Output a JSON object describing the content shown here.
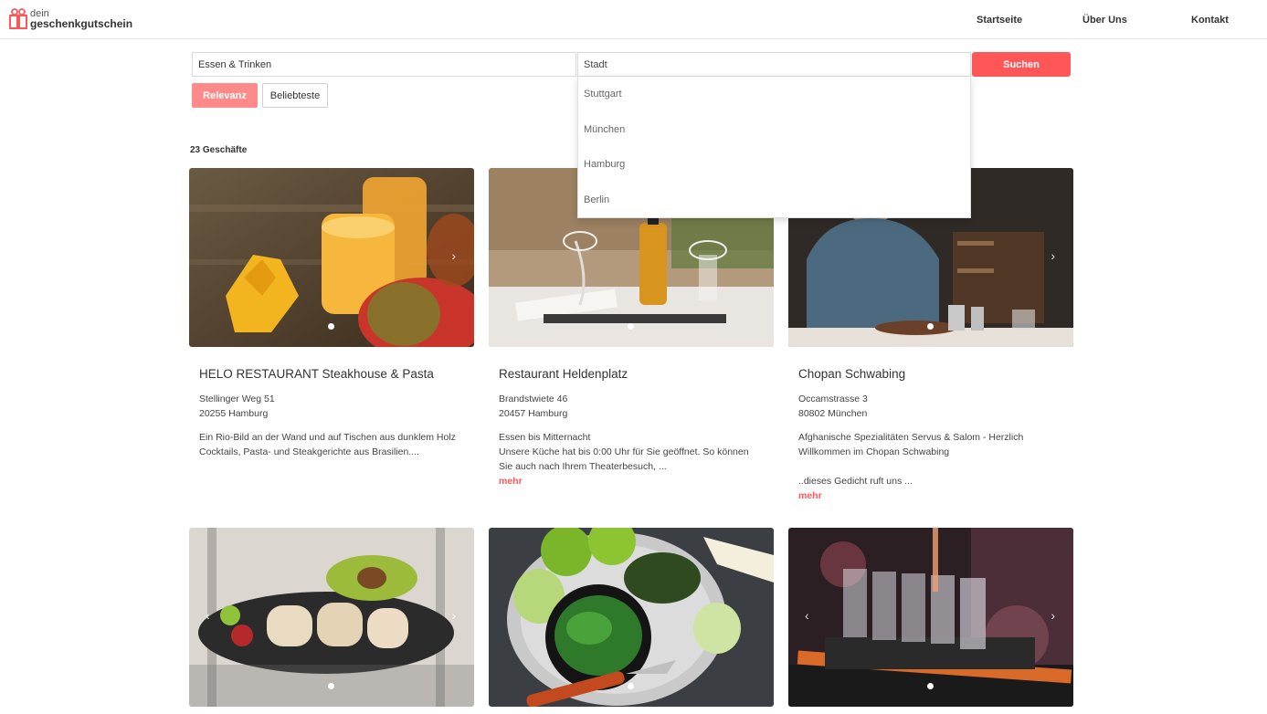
{
  "header": {
    "logo_small": "dein",
    "logo_big": "geschenkgutschein",
    "nav": [
      "Startseite",
      "Über Uns",
      "Kontakt"
    ]
  },
  "search": {
    "category_value": "Essen & Trinken",
    "city_placeholder": "Stadt",
    "submit_label": "Suchen",
    "city_options": [
      "Stuttgart",
      "München",
      "Hamburg",
      "Berlin"
    ]
  },
  "sort": {
    "relevanz": "Relevanz",
    "beliebteste": "Beliebteste"
  },
  "results": {
    "count_label": "23 Geschäfte"
  },
  "colors": {
    "accent": "#ff5757",
    "accent_light": "#ff8a8a"
  },
  "cards": [
    {
      "title": "HELO RESTAURANT Steakhouse & Pasta",
      "street": "Stellinger Weg 51",
      "city": "20255 Hamburg",
      "desc1": "Ein Rio-Bild an der Wand und auf Tischen aus dunklem Holz\nCocktails, Pasta- und Steakgerichte aus Brasilien....",
      "image": "mango-juice-photo"
    },
    {
      "title": "Restaurant Heldenplatz",
      "street": "Brandstwiete 46",
      "city": "20457 Hamburg",
      "desc1": "Essen bis Mitternacht\nUnsere Küche hat bis 0:00 Uhr für Sie geöffnet. So können\nSie auch nach Ihrem Theaterbesuch, ...",
      "more": "mehr",
      "image": "table-glasses-photo"
    },
    {
      "title": "Chopan Schwabing",
      "street": "Occamstrasse 3",
      "city": "80802 München",
      "desc1": "Afghanische Spezialitäten Servus & Salom - Herzlich\nWillkommen im Chopan Schwabing",
      "desc2": "..dieses Gedicht ruft uns ...",
      "more": "mehr",
      "image": "man-dining-photo"
    },
    {
      "image": "wraps-plate-photo"
    },
    {
      "image": "spinach-bowl-photo"
    },
    {
      "image": "shot-glasses-photo"
    }
  ]
}
